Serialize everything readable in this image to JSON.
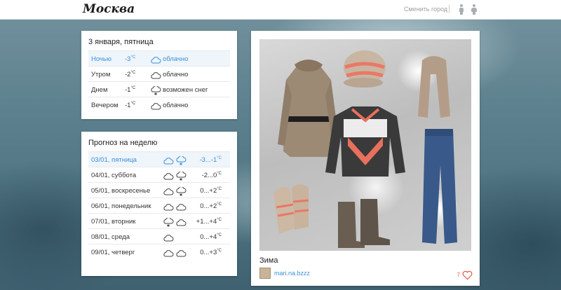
{
  "header": {
    "city": "Москва",
    "change_city": "Сменить город",
    "male_icon": "male-person-icon",
    "female_icon": "female-person-icon"
  },
  "today": {
    "title": "3 января, пятница",
    "rows": [
      {
        "time": "Ночью",
        "temp": "-3",
        "unit": "°C",
        "icon": "cloud-icon",
        "condition": "облачно",
        "active": true
      },
      {
        "time": "Утром",
        "temp": "-2",
        "unit": "°C",
        "icon": "cloud-icon",
        "condition": "облачно",
        "active": false
      },
      {
        "time": "Днем",
        "temp": "-1",
        "unit": "°C",
        "icon": "snow-cloud-icon",
        "condition": "возможен снег",
        "active": false
      },
      {
        "time": "Вечером",
        "temp": "-1",
        "unit": "°C",
        "icon": "cloud-icon",
        "condition": "облачно",
        "active": false
      }
    ]
  },
  "week": {
    "title": "Прогноз на неделю",
    "rows": [
      {
        "date": "03/01, пятница",
        "temp": "-3...-1",
        "unit": "°C",
        "active": true
      },
      {
        "date": "04/01, суббота",
        "temp": "-2...0",
        "unit": "°C",
        "active": false
      },
      {
        "date": "05/01, воскресенье",
        "temp": "0...+2",
        "unit": "°C",
        "active": false
      },
      {
        "date": "06/01, понедельник",
        "temp": "0...+2",
        "unit": "°C",
        "active": false
      },
      {
        "date": "07/01, вторник",
        "temp": "+1...+4",
        "unit": "°C",
        "active": false
      },
      {
        "date": "08/01, среда",
        "temp": "0...+4",
        "unit": "°C",
        "active": false
      },
      {
        "date": "09/01, четверг",
        "temp": "0...+3",
        "unit": "°C",
        "active": false
      }
    ]
  },
  "outfit": {
    "title": "Зима",
    "author": "mari.na.bzzz",
    "likes": "7",
    "like_icon": "heart-icon"
  },
  "colors": {
    "accent": "#3b8fd6",
    "like": "#e35b4b"
  }
}
